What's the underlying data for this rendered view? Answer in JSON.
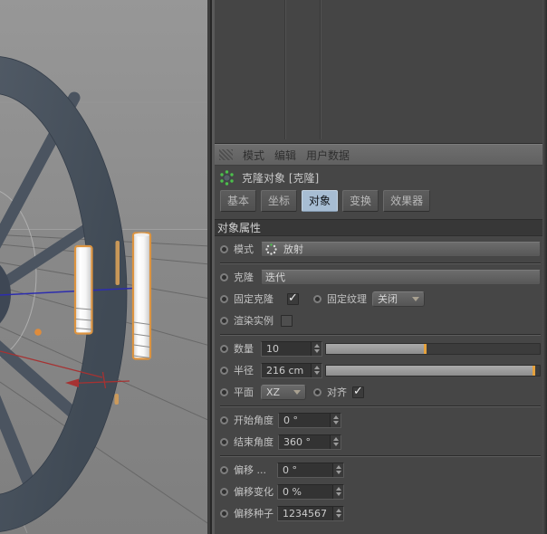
{
  "viewport": {
    "scene": "wheel-with-radial-cloner",
    "background_top": "#969696",
    "ground_color": "#868686",
    "wheel_color": "#4b5460",
    "selection_outline_color": "#dd9440",
    "axis_x_color": "#a63232",
    "axis_z_color": "#2d2dae",
    "clone_marker_color": "#df8c3c"
  },
  "panel": {
    "menu": {
      "items": [
        "模式",
        "编辑",
        "用户数据"
      ]
    },
    "title": {
      "label": "克隆对象 [克隆]"
    },
    "tabs": [
      {
        "label": "基本",
        "selected": false
      },
      {
        "label": "坐标",
        "selected": false
      },
      {
        "label": "对象",
        "selected": true
      },
      {
        "label": "变换",
        "selected": false
      },
      {
        "label": "效果器",
        "selected": false
      }
    ],
    "section_header": "对象属性",
    "rows": {
      "mode": {
        "label": "模式",
        "value": "放射"
      },
      "clone": {
        "label": "克隆",
        "value": "迭代"
      },
      "fix_clone": {
        "label": "固定克隆",
        "checked": true
      },
      "fix_texture": {
        "label": "固定纹理",
        "value": "关闭"
      },
      "render_instances": {
        "label": "渲染实例",
        "checked": false
      },
      "count": {
        "label": "数量",
        "value": "10",
        "slider_pct": 46
      },
      "radius": {
        "label": "半径",
        "value": "216 cm",
        "slider_pct": 97
      },
      "plane": {
        "label": "平面",
        "value": "XZ"
      },
      "align": {
        "label": "对齐",
        "checked": true
      },
      "start_angle": {
        "label": "开始角度",
        "value": "0 °"
      },
      "end_angle": {
        "label": "结束角度",
        "value": "360 °"
      },
      "offset": {
        "label": "偏移 ...",
        "value": "0 °"
      },
      "offset_variation": {
        "label": "偏移变化",
        "value": "0 %"
      },
      "offset_seed": {
        "label": "偏移种子",
        "value": "1234567"
      }
    }
  }
}
